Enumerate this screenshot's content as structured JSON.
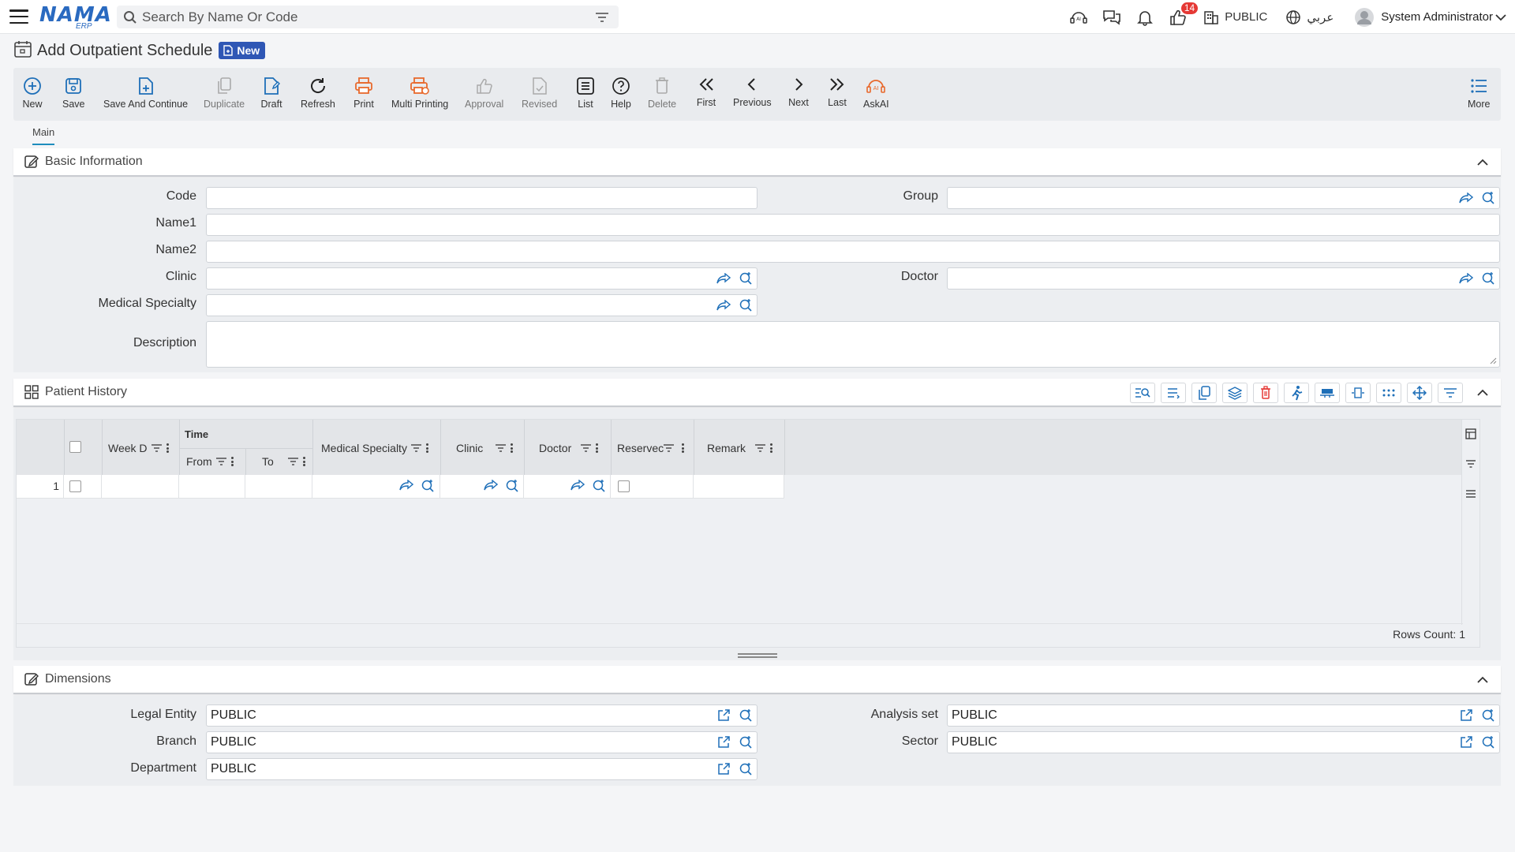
{
  "app": {
    "logo_main": "NAMA",
    "logo_sub": "ERP",
    "search_placeholder": "Search By Name Or Code",
    "notification_count": "14",
    "company": "PUBLIC",
    "language": "عربي",
    "user": "System Administrator"
  },
  "page": {
    "title": "Add Outpatient Schedule",
    "status_badge": "New"
  },
  "toolbar": {
    "new": "New",
    "save": "Save",
    "save_continue": "Save And Continue",
    "duplicate": "Duplicate",
    "draft": "Draft",
    "refresh": "Refresh",
    "print": "Print",
    "multi_printing": "Multi Printing",
    "approval": "Approval",
    "revised": "Revised",
    "list": "List",
    "help": "Help",
    "delete": "Delete",
    "first": "First",
    "previous": "Previous",
    "next": "Next",
    "last": "Last",
    "askai": "AskAI",
    "more": "More"
  },
  "tabs": {
    "main": "Main"
  },
  "basic_info": {
    "title": "Basic Information",
    "code_label": "Code",
    "code_value": "",
    "group_label": "Group",
    "group_value": "",
    "name1_label": "Name1",
    "name1_value": "",
    "name2_label": "Name2",
    "name2_value": "",
    "clinic_label": "Clinic",
    "clinic_value": "",
    "doctor_label": "Doctor",
    "doctor_value": "",
    "specialty_label": "Medical Specialty",
    "specialty_value": "",
    "description_label": "Description",
    "description_value": ""
  },
  "patient_history": {
    "title": "Patient History",
    "columns": {
      "week_day": "Week D",
      "time": "Time",
      "from": "From",
      "to": "To",
      "medical_specialty": "Medical Specialty",
      "clinic": "Clinic",
      "doctor": "Doctor",
      "reserved": "Reservec",
      "remark": "Remark"
    },
    "rows": [
      {
        "index": "1"
      }
    ],
    "rows_count": "Rows Count: 1"
  },
  "dimensions": {
    "title": "Dimensions",
    "legal_entity_label": "Legal Entity",
    "legal_entity_value": "PUBLIC",
    "analysis_set_label": "Analysis set",
    "analysis_set_value": "PUBLIC",
    "branch_label": "Branch",
    "branch_value": "PUBLIC",
    "sector_label": "Sector",
    "sector_value": "PUBLIC",
    "department_label": "Department",
    "department_value": "PUBLIC"
  },
  "colors": {
    "primary_blue": "#1e6fb8",
    "badge_blue": "#2f57b5",
    "orange": "#e8692c",
    "delete_red": "#e53935"
  }
}
